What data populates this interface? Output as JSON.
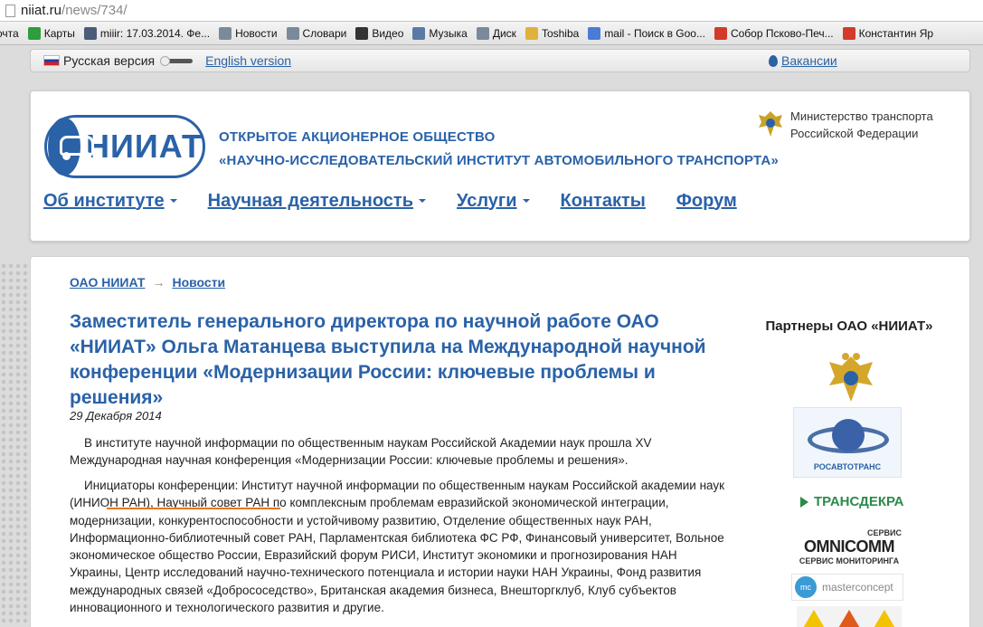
{
  "browser": {
    "url_host": "niiat.ru",
    "url_path": "/news/734/",
    "bookmarks": [
      {
        "label": "очта",
        "icon": "none",
        "color": ""
      },
      {
        "label": "Карты",
        "icon": "maps-icon",
        "color": "#2e9d3d"
      },
      {
        "label": "miiir: 17.03.2014. Фе...",
        "icon": "user-icon",
        "color": "#4b5b7a"
      },
      {
        "label": "Новости",
        "icon": "doc-icon",
        "color": "#7a8a9a"
      },
      {
        "label": "Словари",
        "icon": "doc-icon",
        "color": "#7a8a9a"
      },
      {
        "label": "Видео",
        "icon": "play-icon",
        "color": "#333333"
      },
      {
        "label": "Музыка",
        "icon": "speaker-icon",
        "color": "#5a7aa5"
      },
      {
        "label": "Диск",
        "icon": "doc-icon",
        "color": "#7a8a9a"
      },
      {
        "label": "Toshiba",
        "icon": "folder-icon",
        "color": "#e0b23c"
      },
      {
        "label": "mail - Поиск в Goo...",
        "icon": "google-icon",
        "color": "#4a7cd6"
      },
      {
        "label": "Собор Псково-Печ...",
        "icon": "yandex-icon",
        "color": "#d23a2a"
      },
      {
        "label": "Константин Яр",
        "icon": "yandex-icon",
        "color": "#d23a2a"
      }
    ]
  },
  "langbar": {
    "russian": "Русская версия",
    "english": "English version",
    "vacancies": "Вакансии"
  },
  "header": {
    "logo_text": "НИИАТ",
    "org_line1": "ОТКРЫТОЕ АКЦИОНЕРНОЕ ОБЩЕСТВО",
    "org_line2": "«НАУЧНО-ИССЛЕДОВАТЕЛЬСКИЙ ИНСТИТУТ АВТОМОБИЛЬНОГО ТРАНСПОРТА»",
    "ministry_line1": "Министерство транспорта",
    "ministry_line2": "Российской Федерации",
    "nav": [
      {
        "label": "Об институте",
        "dropdown": true
      },
      {
        "label": "Научная деятельность",
        "dropdown": true
      },
      {
        "label": "Услуги",
        "dropdown": true
      },
      {
        "label": "Контакты",
        "dropdown": false
      },
      {
        "label": "Форум",
        "dropdown": false
      }
    ]
  },
  "article": {
    "breadcrumb_home": "ОАО НИИАТ",
    "breadcrumb_arrow": "→",
    "breadcrumb_section": "Новости",
    "title": "Заместитель генерального директора по научной работе ОАО «НИИАТ» Ольга Матанцева выступила на Международной научной конференции «Модернизации России: ключевые проблемы и решения»",
    "date": "29 Декабря 2014",
    "paragraph1": "В институте научной информации по общественным наукам Российской Академии наук прошла XV Международная научная конференция «Модернизации России: ключевые проблемы и решения».",
    "paragraph2": "Инициаторы конференции: Институт научной информации по общественным наукам Российской академии наук (ИНИОН РАН), Научный совет РАН по комплексным проблемам евразийской экономической интеграции, модернизации, конкурентоспособности и устойчивому развитию, Отделение общественных наук РАН, Информационно-библиотечный совет РАН, Парламентская библиотека ФС РФ, Финансовый университет, Вольное экономическое общество России, Евразийский форум РИСИ, Институт экономики и прогнозирования НАН Украины, Центр исследований научно-технического потенциала и истории науки НАН Украины, Фонд развития международных связей «Добрососедство», Британская академия бизнеса, Внешторгклуб, Клуб субъектов инновационного и технологического развития и другие."
  },
  "partners": {
    "title": "Партнеры ОАО «НИИАТ»",
    "rosavtotrans": "РОСАВТОТРАНС",
    "transdekra": "ТРАНСДЕКРА",
    "omni_top": "СЕРВИС",
    "omni_mid": "OMNICOMM",
    "omni_bot": "СЕРВИС МОНИТОРИНГА",
    "master_mark": "mc",
    "master": "masterconcept"
  }
}
